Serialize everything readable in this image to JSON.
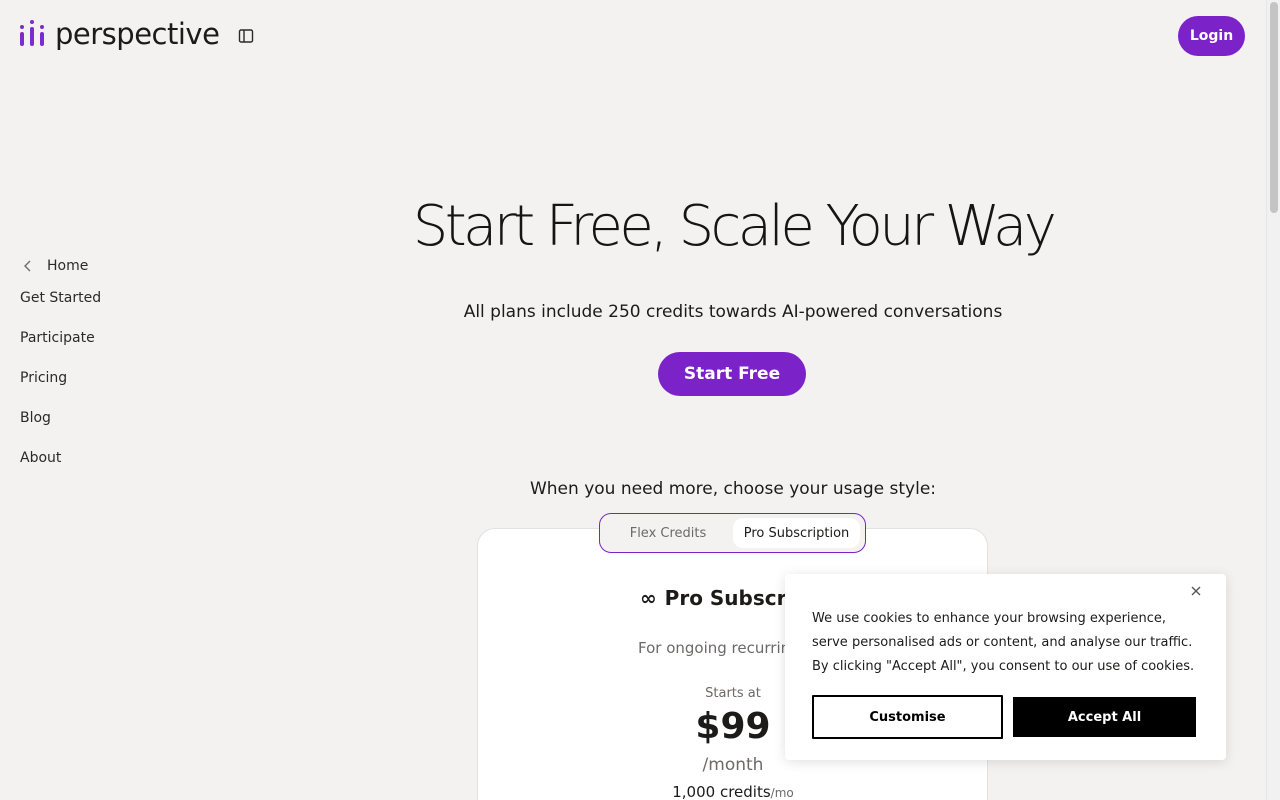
{
  "header": {
    "logo_text": "perspective",
    "login_label": "Login",
    "sidebar_toggle_icon": "sidebar-toggle-icon"
  },
  "sidebar": {
    "home_label": "Home",
    "items": [
      {
        "label": "Get Started"
      },
      {
        "label": "Participate"
      },
      {
        "label": "Pricing"
      },
      {
        "label": "Blog"
      },
      {
        "label": "About"
      }
    ]
  },
  "hero": {
    "title": "Start Free, Scale Your Way",
    "subtitle": "All plans include 250 credits towards AI-powered conversations",
    "cta_label": "Start Free"
  },
  "pricing": {
    "usage_title": "When you need more, choose your usage style:",
    "toggle_options": [
      "Flex Credits",
      "Pro Subscription"
    ],
    "selected_option": "Pro Subscription",
    "plan": {
      "icon": "∞",
      "name": "Pro Subscrip",
      "description": "For ongoing recurrin",
      "starts_at": "Starts at",
      "price": "$99",
      "period": "/month",
      "credits": "1,000 credits",
      "credits_unit": "/mo"
    }
  },
  "cookie_banner": {
    "text": "We use cookies to enhance your browsing experience, serve personalised ads or content, and analyse our traffic. By clicking \"Accept All\", you consent to our use of cookies.",
    "customise_label": "Customise",
    "accept_label": "Accept All"
  },
  "colors": {
    "accent": "#7b22c9",
    "background": "#f4f2f1",
    "card": "#ffffff"
  }
}
